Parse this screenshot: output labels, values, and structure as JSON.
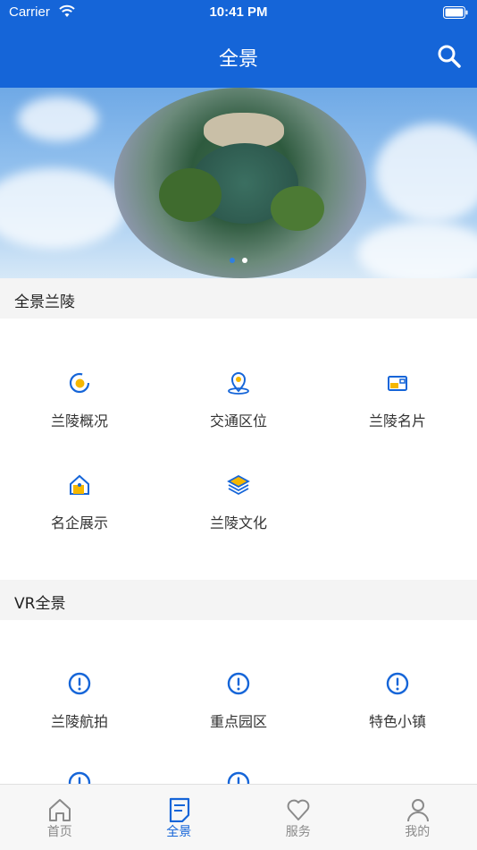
{
  "status_bar": {
    "carrier": "Carrier",
    "time": "10:41 PM"
  },
  "nav": {
    "title": "全景",
    "search_icon": "search-icon"
  },
  "banner": {
    "page_count": 2,
    "active_page": 2
  },
  "sections": [
    {
      "title": "全景兰陵",
      "items": [
        {
          "label": "兰陵概况",
          "icon": "overview-icon"
        },
        {
          "label": "交通区位",
          "icon": "location-pin-icon"
        },
        {
          "label": "兰陵名片",
          "icon": "card-icon"
        },
        {
          "label": "名企展示",
          "icon": "enterprise-house-icon"
        },
        {
          "label": "兰陵文化",
          "icon": "layers-icon"
        }
      ]
    },
    {
      "title": "VR全景",
      "items": [
        {
          "label": "兰陵航拍",
          "icon": "alert-circle-icon"
        },
        {
          "label": "重点园区",
          "icon": "alert-circle-icon"
        },
        {
          "label": "特色小镇",
          "icon": "alert-circle-icon"
        }
      ]
    }
  ],
  "tabs": [
    {
      "label": "首页",
      "icon": "home-icon",
      "active": false
    },
    {
      "label": "全景",
      "icon": "document-icon",
      "active": true
    },
    {
      "label": "服务",
      "icon": "heart-icon",
      "active": false
    },
    {
      "label": "我的",
      "icon": "user-icon",
      "active": false
    }
  ],
  "colors": {
    "primary": "#1565d8",
    "accent_yellow": "#f5b700",
    "tab_inactive": "#8a8a8a"
  }
}
